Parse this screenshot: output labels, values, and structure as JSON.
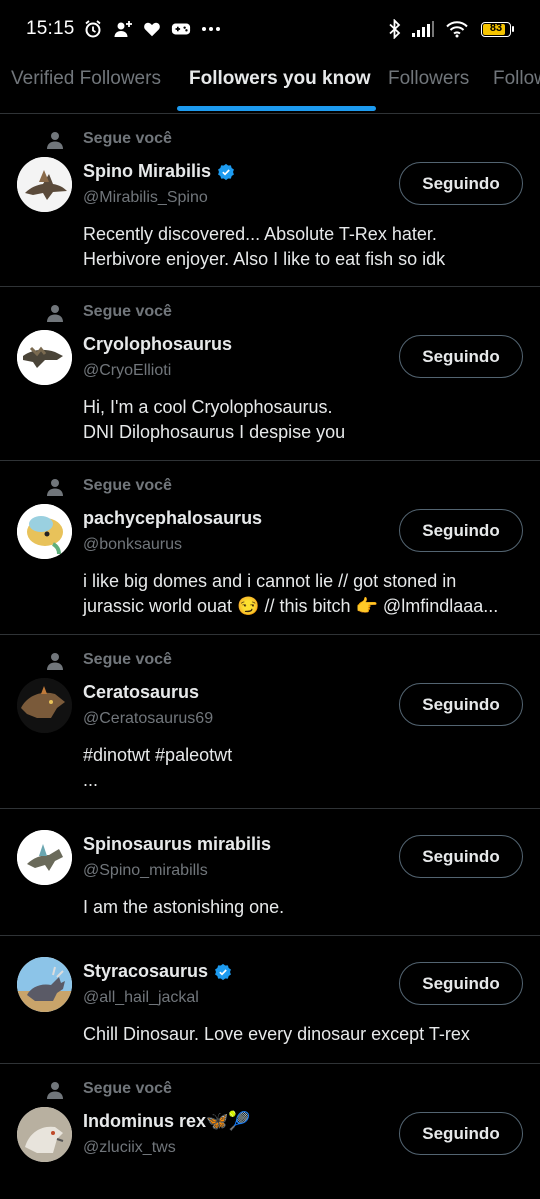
{
  "status_bar": {
    "time": "15:15",
    "icons": [
      "alarm-icon",
      "person-add-icon",
      "heart-icon",
      "game-controller-icon",
      "more-dots-icon"
    ],
    "right_icons": [
      "bluetooth-icon",
      "signal-icon",
      "wifi-icon"
    ],
    "battery": "83",
    "battery_level": 0.83,
    "battery_color": "#f5c400"
  },
  "tabs": [
    {
      "label": "Verified Followers",
      "active": false
    },
    {
      "label": "Followers you know",
      "active": true
    },
    {
      "label": "Followers",
      "active": false
    },
    {
      "label": "Follow",
      "active": false
    }
  ],
  "accent_color": "#1d9bf0",
  "followed_label": "Segue você",
  "button_label": "Seguindo",
  "users": [
    {
      "name": "Spino Mirabilis",
      "verified": true,
      "handle": "@Mirabilis_Spino",
      "follows_you": true,
      "bio_lines": [
        "Recently discovered... Absolute T-Rex hater.",
        "Herbivore enjoyer. Also I like to eat fish so idk"
      ]
    },
    {
      "name": "Cryolophosaurus",
      "verified": false,
      "handle": "@CryoEllioti",
      "follows_you": true,
      "bio_lines": [
        "Hi, I'm a cool Cryolophosaurus.",
        "DNI Dilophosaurus I despise you"
      ]
    },
    {
      "name": "pachycephalosaurus",
      "verified": false,
      "handle": "@bonksaurus",
      "follows_you": true,
      "bio_lines": [
        "i like big domes and i cannot lie // got stoned in",
        "jurassic world ouat 😏 // this bitch 👉 @lmfindlaaa..."
      ]
    },
    {
      "name": "Ceratosaurus",
      "verified": false,
      "handle": "@Ceratosaurus69",
      "follows_you": true,
      "bio_lines": [
        "#dinotwt #paleotwt",
        "..."
      ]
    },
    {
      "name": "Spinosaurus mirabilis",
      "verified": false,
      "handle": "@Spino_mirabills",
      "follows_you": false,
      "bio_lines": [
        "I am the astonishing one."
      ]
    },
    {
      "name": "Styracosaurus",
      "verified": true,
      "handle": "@all_hail_jackal",
      "follows_you": false,
      "bio_lines": [
        "Chill Dinosaur. Love every dinosaur except T-rex"
      ]
    },
    {
      "name": "Indominus rex🦋🎾",
      "verified": false,
      "handle": "@zluciix_tws",
      "follows_you": true,
      "bio_lines": []
    }
  ]
}
